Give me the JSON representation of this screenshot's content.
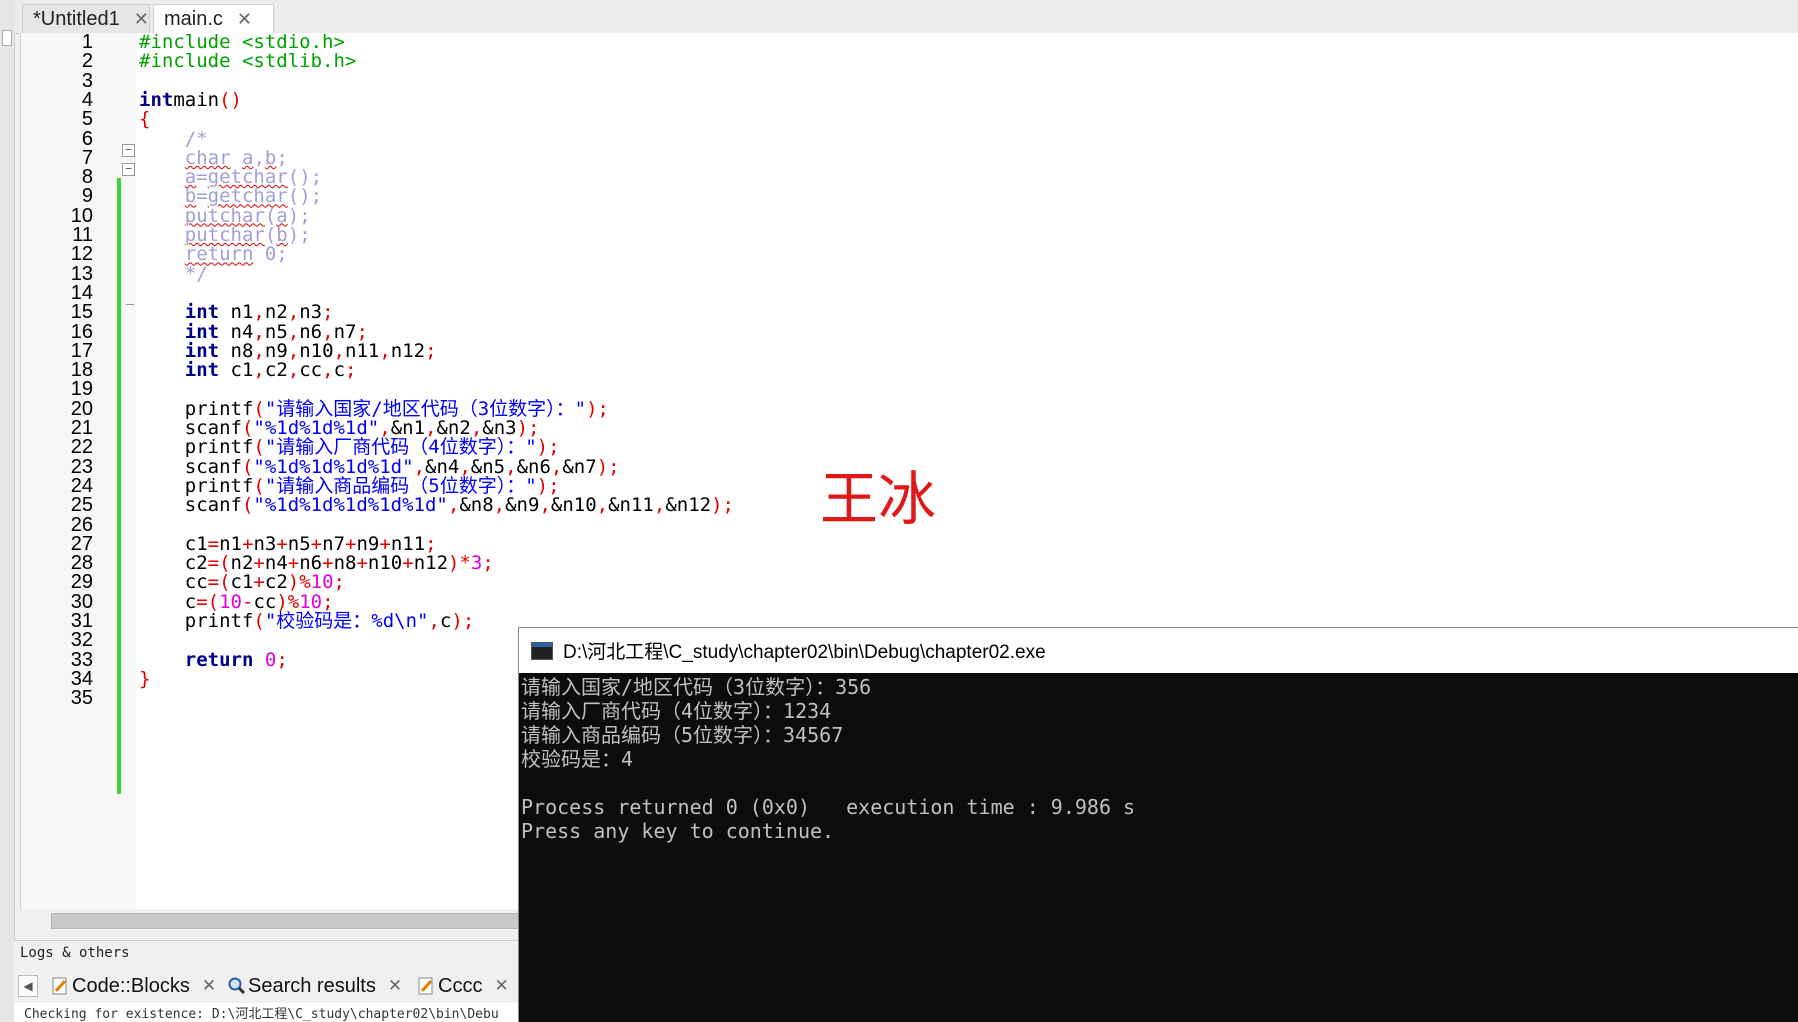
{
  "tabs": [
    {
      "label": "*Untitled1",
      "close": "✕"
    },
    {
      "label": "main.c",
      "close": "✕"
    }
  ],
  "editor": {
    "line_numbers": [
      "1",
      "2",
      "3",
      "4",
      "5",
      "6",
      "7",
      "8",
      "9",
      "10",
      "11",
      "12",
      "13",
      "14",
      "15",
      "16",
      "17",
      "18",
      "19",
      "20",
      "21",
      "22",
      "23",
      "24",
      "25",
      "26",
      "27",
      "28",
      "29",
      "30",
      "31",
      "32",
      "33",
      "34",
      "35"
    ],
    "lines": [
      [
        [
          "pp",
          "#include <stdio.h>"
        ]
      ],
      [
        [
          "pp",
          "#include <stdlib.h>"
        ]
      ],
      [],
      [
        [
          "kw",
          "int"
        ],
        [
          "",
          "main"
        ],
        [
          "op",
          "()"
        ]
      ],
      [
        [
          "op",
          "{"
        ]
      ],
      [
        [
          "cm",
          "    /*"
        ]
      ],
      [
        [
          "cm",
          "    "
        ],
        [
          "cm sq",
          "char"
        ],
        [
          "cm",
          " "
        ],
        [
          "cm sq",
          "a"
        ],
        [
          "cm",
          ","
        ],
        [
          "cm sq",
          "b"
        ],
        [
          "cm",
          ";"
        ]
      ],
      [
        [
          "cm",
          "    "
        ],
        [
          "cm sq",
          "a"
        ],
        [
          "cm",
          "="
        ],
        [
          "cm sq",
          "getchar"
        ],
        [
          "cm",
          "();"
        ]
      ],
      [
        [
          "cm",
          "    "
        ],
        [
          "cm sq",
          "b"
        ],
        [
          "cm",
          "="
        ],
        [
          "cm sq",
          "getchar"
        ],
        [
          "cm",
          "();"
        ]
      ],
      [
        [
          "cm",
          "    "
        ],
        [
          "cm sq",
          "putchar"
        ],
        [
          "cm",
          "("
        ],
        [
          "cm sq",
          "a"
        ],
        [
          "cm",
          ");"
        ]
      ],
      [
        [
          "cm",
          "    "
        ],
        [
          "cm sq",
          "putchar"
        ],
        [
          "cm",
          "("
        ],
        [
          "cm sq",
          "b"
        ],
        [
          "cm",
          ");"
        ]
      ],
      [
        [
          "cm",
          "    "
        ],
        [
          "cm sq",
          "return"
        ],
        [
          "cm",
          " 0;"
        ]
      ],
      [
        [
          "cm",
          "    */"
        ]
      ],
      [],
      [
        [
          "",
          "    "
        ],
        [
          "kw",
          "int"
        ],
        [
          "",
          " n1"
        ],
        [
          "op",
          ","
        ],
        [
          "",
          "n2"
        ],
        [
          "op",
          ","
        ],
        [
          "",
          "n3"
        ],
        [
          "op",
          ";"
        ]
      ],
      [
        [
          "",
          "    "
        ],
        [
          "kw",
          "int"
        ],
        [
          "",
          " n4"
        ],
        [
          "op",
          ","
        ],
        [
          "",
          "n5"
        ],
        [
          "op",
          ","
        ],
        [
          "",
          "n6"
        ],
        [
          "op",
          ","
        ],
        [
          "",
          "n7"
        ],
        [
          "op",
          ";"
        ]
      ],
      [
        [
          "",
          "    "
        ],
        [
          "kw",
          "int"
        ],
        [
          "",
          " n8"
        ],
        [
          "op",
          ","
        ],
        [
          "",
          "n9"
        ],
        [
          "op",
          ","
        ],
        [
          "",
          "n10"
        ],
        [
          "op",
          ","
        ],
        [
          "",
          "n11"
        ],
        [
          "op",
          ","
        ],
        [
          "",
          "n12"
        ],
        [
          "op",
          ";"
        ]
      ],
      [
        [
          "",
          "    "
        ],
        [
          "kw",
          "int"
        ],
        [
          "",
          " c1"
        ],
        [
          "op",
          ","
        ],
        [
          "",
          "c2"
        ],
        [
          "op",
          ","
        ],
        [
          "",
          "cc"
        ],
        [
          "op",
          ","
        ],
        [
          "",
          "c"
        ],
        [
          "op",
          ";"
        ]
      ],
      [],
      [
        [
          "",
          "    printf"
        ],
        [
          "op",
          "("
        ],
        [
          "str",
          "\"请输入国家/地区代码（3位数字）：\""
        ],
        [
          "op",
          ");"
        ]
      ],
      [
        [
          "",
          "    scanf"
        ],
        [
          "op",
          "("
        ],
        [
          "str",
          "\"%1d%1d%1d\""
        ],
        [
          "op",
          ","
        ],
        [
          "",
          "&n1"
        ],
        [
          "op",
          ","
        ],
        [
          "",
          "&n2"
        ],
        [
          "op",
          ","
        ],
        [
          "",
          "&n3"
        ],
        [
          "op",
          ");"
        ]
      ],
      [
        [
          "",
          "    printf"
        ],
        [
          "op",
          "("
        ],
        [
          "str",
          "\"请输入厂商代码（4位数字）：\""
        ],
        [
          "op",
          ");"
        ]
      ],
      [
        [
          "",
          "    scanf"
        ],
        [
          "op",
          "("
        ],
        [
          "str",
          "\"%1d%1d%1d%1d\""
        ],
        [
          "op",
          ","
        ],
        [
          "",
          "&n4"
        ],
        [
          "op",
          ","
        ],
        [
          "",
          "&n5"
        ],
        [
          "op",
          ","
        ],
        [
          "",
          "&n6"
        ],
        [
          "op",
          ","
        ],
        [
          "",
          "&n7"
        ],
        [
          "op",
          ");"
        ]
      ],
      [
        [
          "",
          "    printf"
        ],
        [
          "op",
          "("
        ],
        [
          "str",
          "\"请输入商品编码（5位数字）：\""
        ],
        [
          "op",
          ");"
        ]
      ],
      [
        [
          "",
          "    scanf"
        ],
        [
          "op",
          "("
        ],
        [
          "str",
          "\"%1d%1d%1d%1d%1d\""
        ],
        [
          "op",
          ","
        ],
        [
          "",
          "&n8"
        ],
        [
          "op",
          ","
        ],
        [
          "",
          "&n9"
        ],
        [
          "op",
          ","
        ],
        [
          "",
          "&n10"
        ],
        [
          "op",
          ","
        ],
        [
          "",
          "&n11"
        ],
        [
          "op",
          ","
        ],
        [
          "",
          "&n12"
        ],
        [
          "op",
          ");"
        ]
      ],
      [],
      [
        [
          "",
          "    c1"
        ],
        [
          "op",
          "="
        ],
        [
          "",
          "n1"
        ],
        [
          "op",
          "+"
        ],
        [
          "",
          "n3"
        ],
        [
          "op",
          "+"
        ],
        [
          "",
          "n5"
        ],
        [
          "op",
          "+"
        ],
        [
          "",
          "n7"
        ],
        [
          "op",
          "+"
        ],
        [
          "",
          "n9"
        ],
        [
          "op",
          "+"
        ],
        [
          "",
          "n11"
        ],
        [
          "op",
          ";"
        ]
      ],
      [
        [
          "",
          "    c2"
        ],
        [
          "op",
          "=("
        ],
        [
          "",
          "n2"
        ],
        [
          "op",
          "+"
        ],
        [
          "",
          "n4"
        ],
        [
          "op",
          "+"
        ],
        [
          "",
          "n6"
        ],
        [
          "op",
          "+"
        ],
        [
          "",
          "n8"
        ],
        [
          "op",
          "+"
        ],
        [
          "",
          "n10"
        ],
        [
          "op",
          "+"
        ],
        [
          "",
          "n12"
        ],
        [
          "op",
          ")*"
        ],
        [
          "num",
          "3"
        ],
        [
          "op",
          ";"
        ]
      ],
      [
        [
          "",
          "    cc"
        ],
        [
          "op",
          "=("
        ],
        [
          "",
          "c1"
        ],
        [
          "op",
          "+"
        ],
        [
          "",
          "c2"
        ],
        [
          "op",
          ")%"
        ],
        [
          "num",
          "10"
        ],
        [
          "op",
          ";"
        ]
      ],
      [
        [
          "",
          "    c"
        ],
        [
          "op",
          "=("
        ],
        [
          "num",
          "10"
        ],
        [
          "op",
          "-"
        ],
        [
          "",
          "cc"
        ],
        [
          "op",
          ")%"
        ],
        [
          "num",
          "10"
        ],
        [
          "op",
          ";"
        ]
      ],
      [
        [
          "",
          "    printf"
        ],
        [
          "op",
          "("
        ],
        [
          "str",
          "\"校验码是：%d\\n\""
        ],
        [
          "op",
          ","
        ],
        [
          "",
          "c"
        ],
        [
          "op",
          ");"
        ]
      ],
      [],
      [
        [
          "",
          "    "
        ],
        [
          "kw",
          "return"
        ],
        [
          "",
          " "
        ],
        [
          "num",
          "0"
        ],
        [
          "op",
          ";"
        ]
      ],
      [
        [
          "op",
          "}"
        ]
      ],
      []
    ]
  },
  "watermark": "王冰",
  "logs": {
    "title": "Logs & others",
    "tabs": [
      {
        "label": "Code::Blocks",
        "close": "✕"
      },
      {
        "label": "Search results",
        "close": "✕"
      },
      {
        "label": "Cccc",
        "close": "✕"
      }
    ],
    "body": "Checking for existence: D:\\河北工程\\C_study\\chapter02\\bin\\Debu"
  },
  "console": {
    "title": "D:\\河北工程\\C_study\\chapter02\\bin\\Debug\\chapter02.exe",
    "lines": [
      "请输入国家/地区代码（3位数字）：356",
      "请输入厂商代码（4位数字）：1234",
      "请输入商品编码（5位数字）：34567",
      "校验码是：4",
      "",
      "Process returned 0 (0x0)   execution time : 9.986 s",
      "Press any key to continue."
    ]
  }
}
